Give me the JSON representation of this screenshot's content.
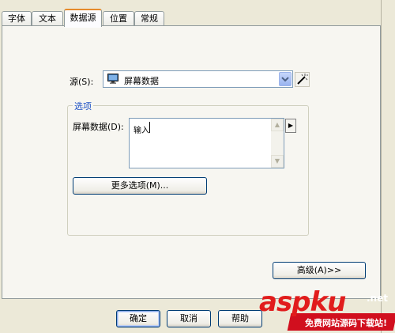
{
  "tabs": [
    {
      "label": "字体",
      "active": false
    },
    {
      "label": "文本",
      "active": false
    },
    {
      "label": "数据源",
      "active": true
    },
    {
      "label": "位置",
      "active": false
    },
    {
      "label": "常规",
      "active": false
    }
  ],
  "source": {
    "label": "源(S):",
    "selected": "屏幕数据",
    "icon": "monitor-icon",
    "builder_icon": "magic-wand-icon"
  },
  "options": {
    "title": "选项",
    "screen_data_label": "屏幕数据(D):",
    "screen_data_value": "输入",
    "more_options_button": "更多选项(M)..."
  },
  "advanced_button": "高级(A)>>",
  "footer": {
    "ok": "确定",
    "cancel": "取消",
    "help": "帮助"
  },
  "watermark": {
    "logo": "aspku",
    "domain": ".net",
    "tagline": "免费网站源码下载站!"
  },
  "colors": {
    "dialog_bg": "#ece9d8",
    "active_tab_accent": "#e68b2c",
    "group_title": "#1b4fc4",
    "watermark_red": "#e11c1c"
  }
}
